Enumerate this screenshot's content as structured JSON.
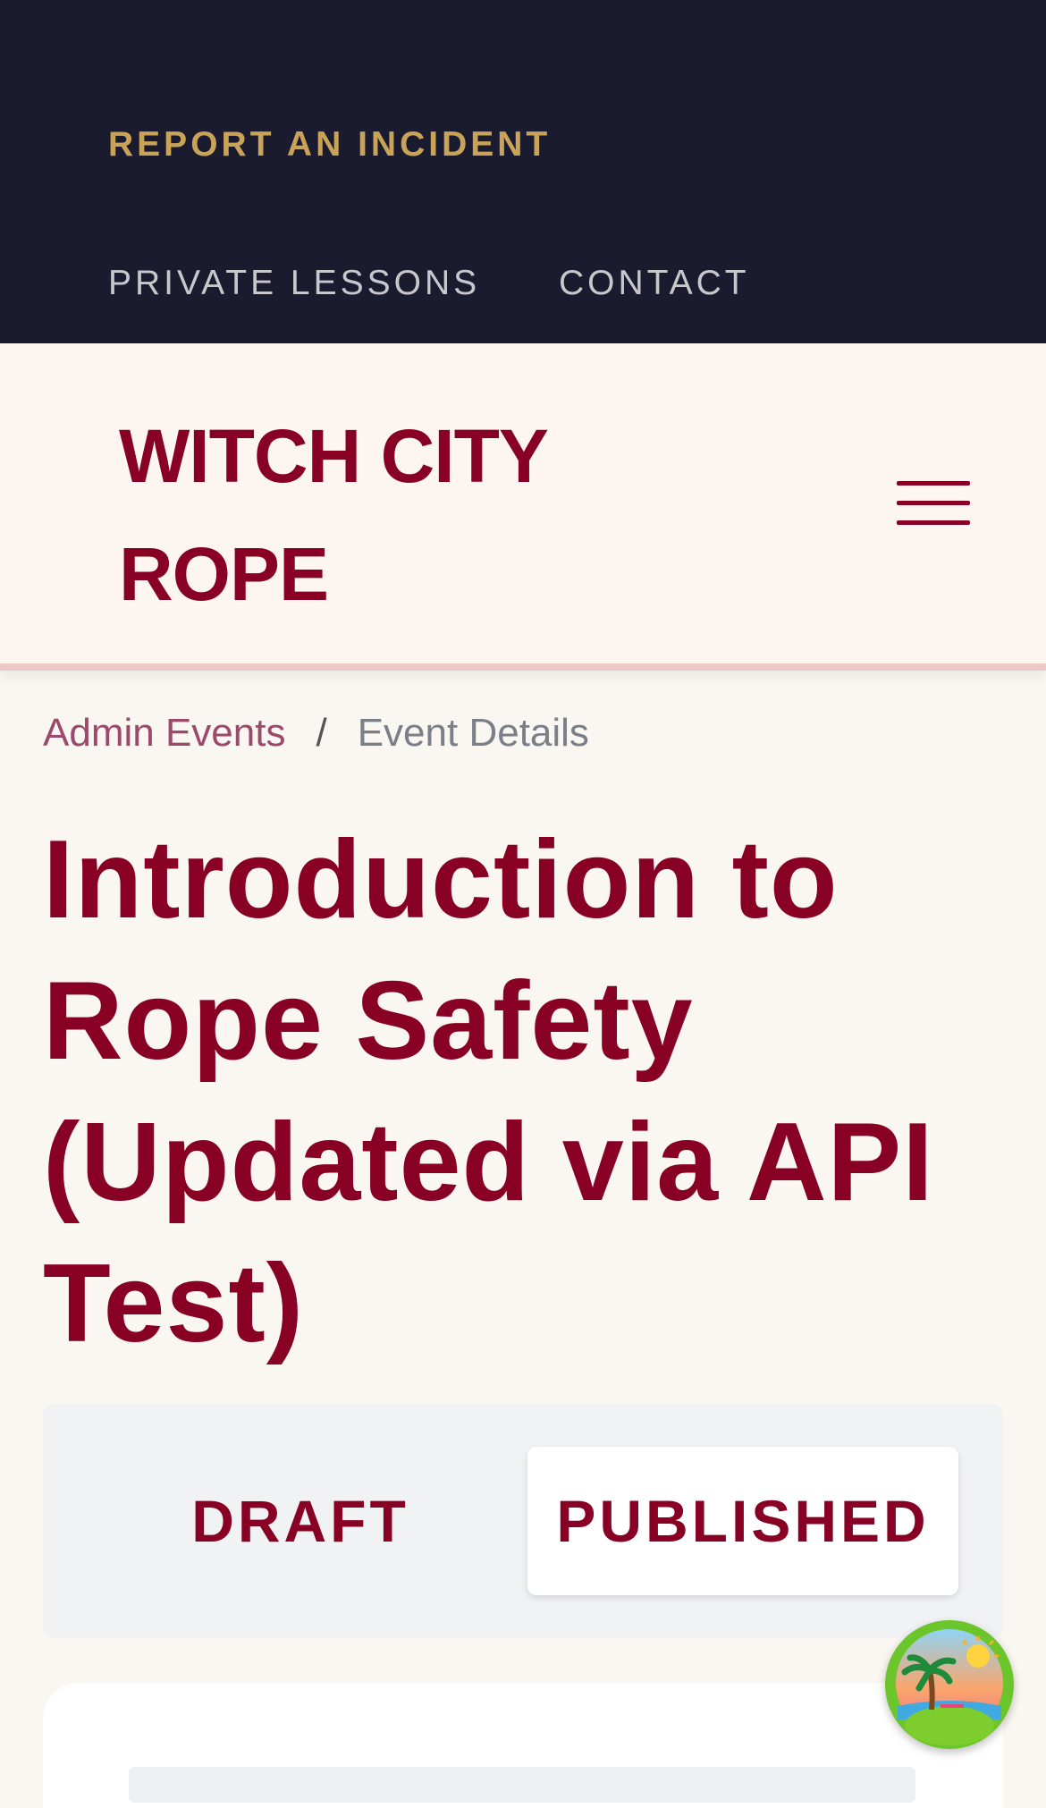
{
  "utility_bar": {
    "incident_label": "REPORT AN INCIDENT",
    "links": [
      "PRIVATE LESSONS",
      "CONTACT"
    ]
  },
  "brand": {
    "name": "WITCH CITY ROPE"
  },
  "breadcrumb": {
    "parent": "Admin Events",
    "separator": "/",
    "current": "Event Details"
  },
  "event": {
    "title": "Introduction to Rope Safety (Updated via API Test)"
  },
  "status_toggle": {
    "options": [
      "DRAFT",
      "PUBLISHED"
    ],
    "selected": "PUBLISHED"
  },
  "icons": {
    "menu": "hamburger-menu-icon",
    "assistant": "island-sunset-icon"
  },
  "colors": {
    "brand": "#880124",
    "nav_bg": "#1b1b2f",
    "incident_gold": "#c9a458",
    "page_bg": "#faf6f2"
  }
}
